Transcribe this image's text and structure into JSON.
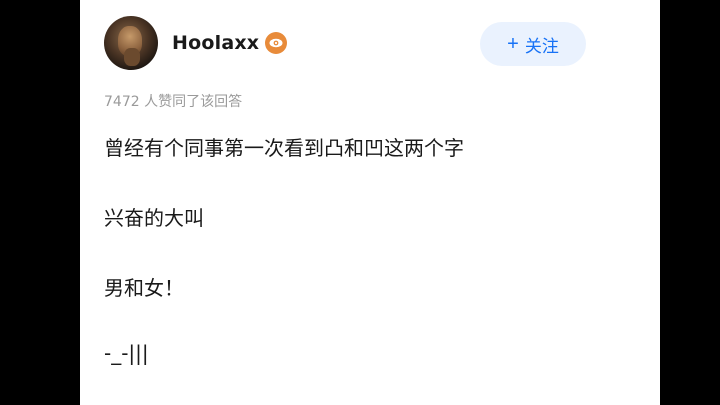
{
  "author": {
    "name": "Hoolaxx",
    "badge_icon": "eye-icon",
    "avatar_icon": "avatar-image"
  },
  "follow_button": {
    "icon": "plus-icon",
    "label": "关注"
  },
  "meta": {
    "likes_text": "7472 人赞同了该回答"
  },
  "content": {
    "paragraphs": [
      "曾经有个同事第一次看到凸和凹这两个字",
      "兴奋的大叫",
      "男和女！",
      "-_-|||"
    ]
  },
  "colors": {
    "accent": "#1772f6",
    "follow_bg": "#eaf2fe",
    "badge": "#e88b3a",
    "text": "#1a1a1a",
    "muted": "#9a9a9a"
  }
}
